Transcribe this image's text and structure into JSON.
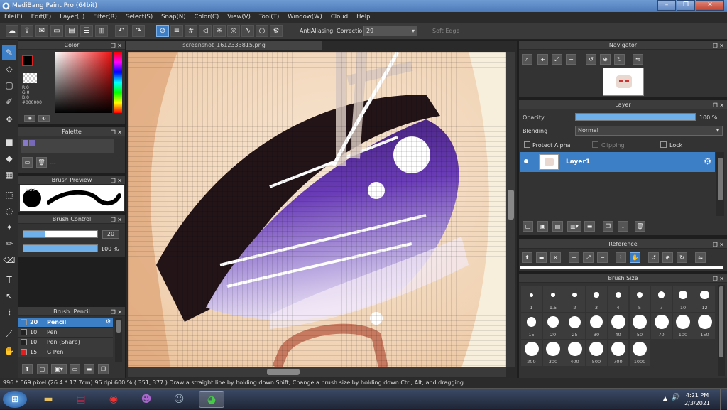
{
  "window": {
    "title": "MediBang Paint Pro (64bit)"
  },
  "menu": [
    "File(F)",
    "Edit(E)",
    "Layer(L)",
    "Filter(R)",
    "Select(S)",
    "Snap(N)",
    "Color(C)",
    "View(V)",
    "Tool(T)",
    "Window(W)",
    "Cloud",
    "Help"
  ],
  "toolbar": {
    "antialias_label": "AntiAliasing",
    "correction_label": "Correction",
    "correction_value": "29",
    "softedge_label": "Soft Edge"
  },
  "color_panel": {
    "title": "Color",
    "r": "R:0",
    "g": "G:0",
    "b": "B:0",
    "hex": "#000000"
  },
  "palette_panel": {
    "title": "Palette",
    "text": "---"
  },
  "brush_preview": {
    "title": "Brush Preview",
    "size": "5.29"
  },
  "brush_control": {
    "title": "Brush Control",
    "size_value": "20",
    "opacity_value": "100 %",
    "size_fraction": 0.3,
    "opacity_fraction": 1.0
  },
  "brush_list": {
    "title": "Brush: Pencil",
    "items": [
      {
        "size": "20",
        "name": "Pencil",
        "color": "#222222"
      },
      {
        "size": "10",
        "name": "Pen",
        "color": "#222222"
      },
      {
        "size": "10",
        "name": "Pen (Sharp)",
        "color": "#222222"
      },
      {
        "size": "15",
        "name": "G Pen",
        "color": "#e02020"
      }
    ]
  },
  "canvas": {
    "tab": "screenshot_1612333815.png"
  },
  "navigator": {
    "title": "Navigator"
  },
  "layer_panel": {
    "title": "Layer",
    "opacity_label": "Opacity",
    "opacity_value": "100 %",
    "opacity_fraction": 1.0,
    "blending_label": "Blending",
    "blending_value": "Normal",
    "protect_alpha": "Protect Alpha",
    "clipping": "Clipping",
    "lock": "Lock",
    "layer_name": "Layer1"
  },
  "reference": {
    "title": "Reference"
  },
  "brush_size": {
    "title": "Brush Size",
    "sizes": [
      "1",
      "1.5",
      "2",
      "3",
      "4",
      "5",
      "7",
      "10",
      "12",
      "15",
      "20",
      "25",
      "30",
      "40",
      "50",
      "70",
      "100",
      "150",
      "200",
      "300",
      "400",
      "500",
      "700",
      "1000"
    ]
  },
  "status": {
    "text": "996 * 669 pixel   (26.4 * 17.7cm)   96 dpi   600 %   ( 351, 377 )   Draw a straight line by holding down Shift, Change a brush size by holding down Ctrl, Alt, and dragging"
  },
  "clock": {
    "time": "4:21 PM",
    "date": "2/3/2021"
  },
  "colors": {
    "accent": "#3d7fc7",
    "panel": "#333333",
    "canvas_purple": "#5a2aa0"
  }
}
